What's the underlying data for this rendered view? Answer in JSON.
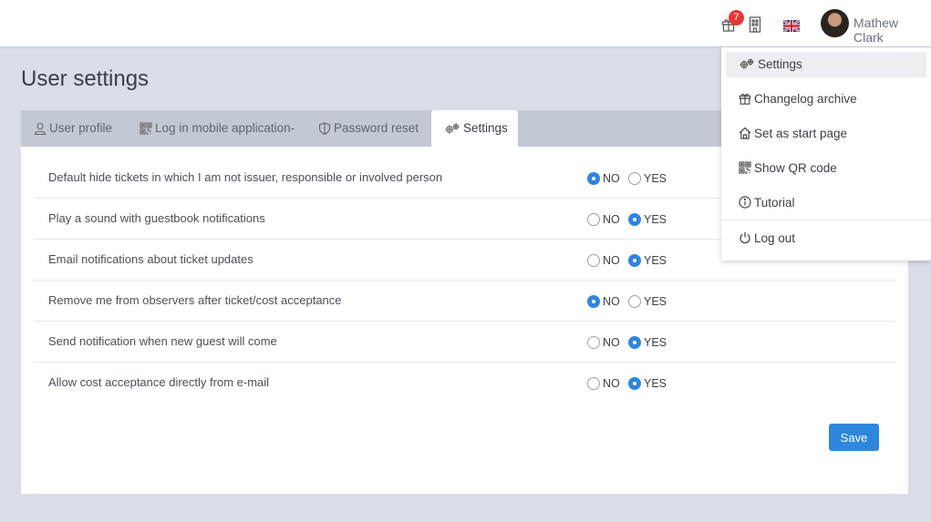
{
  "header": {
    "notification_count": "7",
    "user_name": "Mathew Clark",
    "icons": [
      "gift-icon",
      "building-icon",
      "uk-flag-icon",
      "avatar"
    ]
  },
  "page": {
    "title": "User settings"
  },
  "tabs": [
    {
      "label": "User profile",
      "icon": "user-icon",
      "active": false
    },
    {
      "label": "Log in mobile application-",
      "icon": "qr-code-icon",
      "active": false
    },
    {
      "label": "Password reset",
      "icon": "shield-icon",
      "active": false
    },
    {
      "label": "Settings",
      "icon": "gears-icon",
      "active": true
    }
  ],
  "options": {
    "no_label": "NO",
    "yes_label": "YES"
  },
  "settings": [
    {
      "label": "Default hide tickets in which I am not issuer, responsible or involved person",
      "value": "NO"
    },
    {
      "label": "Play a sound with guestbook notifications",
      "value": "YES"
    },
    {
      "label": "Email notifications about ticket updates",
      "value": "YES"
    },
    {
      "label": "Remove me from observers after ticket/cost acceptance",
      "value": "NO"
    },
    {
      "label": "Send notification when new guest will come",
      "value": "YES"
    },
    {
      "label": "Allow cost acceptance directly from e-mail",
      "value": "YES"
    }
  ],
  "save_label": "Save",
  "user_menu": [
    {
      "label": "Settings",
      "icon": "gears-icon"
    },
    {
      "label": "Changelog archive",
      "icon": "gift-icon"
    },
    {
      "label": "Set as start page",
      "icon": "home-icon"
    },
    {
      "label": "Show QR code",
      "icon": "qr-code-icon"
    },
    {
      "label": "Tutorial",
      "icon": "info-icon"
    },
    {
      "label": "Log out",
      "icon": "power-icon"
    }
  ],
  "colors": {
    "accent": "#2e86de",
    "badge": "#e53935"
  }
}
